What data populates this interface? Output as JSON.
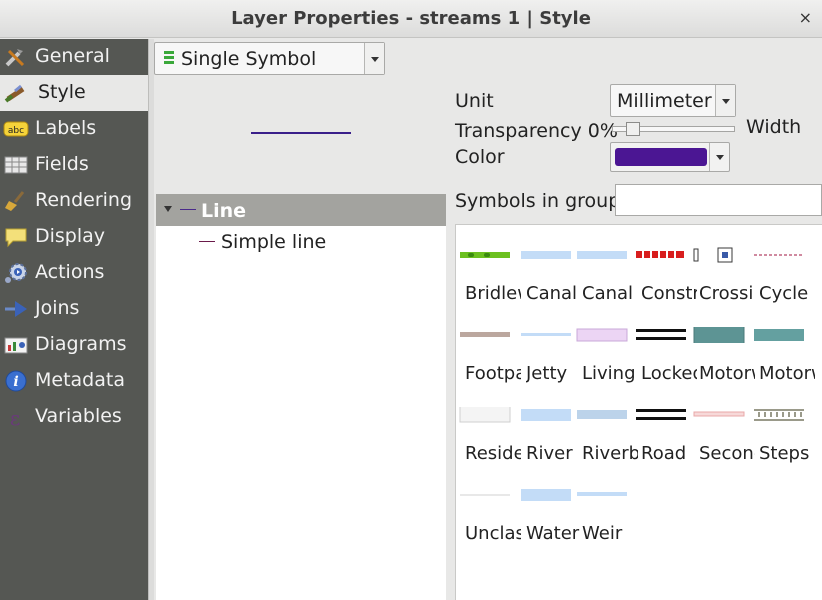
{
  "window": {
    "title": "Layer Properties - streams 1 | Style",
    "close_label": "×"
  },
  "sidebar": {
    "items": [
      {
        "label": "General",
        "icon": "tools-icon",
        "active": false
      },
      {
        "label": "Style",
        "icon": "paintbrush-icon",
        "active": true
      },
      {
        "label": "Labels",
        "icon": "abc-label-icon",
        "active": false
      },
      {
        "label": "Fields",
        "icon": "table-icon",
        "active": false
      },
      {
        "label": "Rendering",
        "icon": "broom-icon",
        "active": false
      },
      {
        "label": "Display",
        "icon": "speech-bubble-icon",
        "active": false
      },
      {
        "label": "Actions",
        "icon": "gear-play-icon",
        "active": false
      },
      {
        "label": "Joins",
        "icon": "join-icon",
        "active": false
      },
      {
        "label": "Diagrams",
        "icon": "diagram-icon",
        "active": false
      },
      {
        "label": "Metadata",
        "icon": "info-icon",
        "active": false
      },
      {
        "label": "Variables",
        "icon": "epsilon-icon",
        "active": false
      }
    ]
  },
  "renderer": {
    "selected": "Single Symbol",
    "icon": "single-symbol-icon"
  },
  "symbol_tree": {
    "root_label": "Line",
    "child_label": "Simple line"
  },
  "properties": {
    "unit_label": "Unit",
    "unit_value": "Millimeter",
    "transparency_label": "Transparency 0%",
    "transparency_value": 0,
    "width_label": "Width",
    "color_label": "Color",
    "color_value": "#4b1693"
  },
  "symbols_in_group": {
    "label": "Symbols in group",
    "input_value": "",
    "items": [
      {
        "name": "Bridleway",
        "style": "bridleway"
      },
      {
        "name": "Canal",
        "style": "canal"
      },
      {
        "name": "Canal",
        "style": "canal"
      },
      {
        "name": "Construction",
        "style": "construction"
      },
      {
        "name": "Crossing",
        "style": "crossing"
      },
      {
        "name": "Cycle",
        "style": "cycle"
      },
      {
        "name": "Footpath",
        "style": "footpath"
      },
      {
        "name": "Jetty",
        "style": "jetty"
      },
      {
        "name": "Living",
        "style": "living"
      },
      {
        "name": "Locked",
        "style": "locked"
      },
      {
        "name": "Motorway",
        "style": "motorway"
      },
      {
        "name": "Motorway",
        "style": "motorway2"
      },
      {
        "name": "Residential",
        "style": "residential"
      },
      {
        "name": "River",
        "style": "river"
      },
      {
        "name": "Riverbank",
        "style": "riverbank"
      },
      {
        "name": "Road",
        "style": "road"
      },
      {
        "name": "Secondary",
        "style": "secondary"
      },
      {
        "name": "Steps",
        "style": "steps"
      },
      {
        "name": "Unclassified",
        "style": "unclassified"
      },
      {
        "name": "Water",
        "style": "water"
      },
      {
        "name": "Weir",
        "style": "weir"
      }
    ]
  }
}
